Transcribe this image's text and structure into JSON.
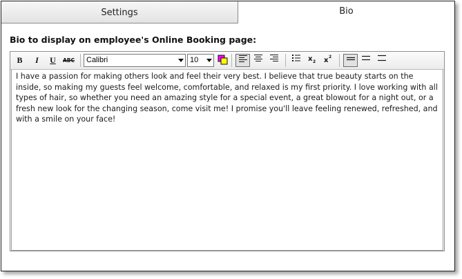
{
  "tabs": [
    {
      "label": "Settings"
    },
    {
      "label": "Bio"
    }
  ],
  "section_heading": "Bio to display on employee's Online Booking page:",
  "toolbar": {
    "bold_label": "B",
    "italic_label": "I",
    "underline_label": "U",
    "strikethrough_label": "ABC",
    "font_family": "Calibri",
    "font_size": "10",
    "colors": {
      "highlight_fg": "#ff00ff",
      "highlight_bg": "#ffff00"
    },
    "icons": [
      "align-left-icon",
      "align-center-icon",
      "align-right-icon",
      "bullet-list-icon",
      "subscript-icon",
      "superscript-icon",
      "line-spacing-single-icon",
      "line-spacing-1-5-icon",
      "line-spacing-double-icon"
    ]
  },
  "bio_text": "I have a passion for making others look and feel their very best. I believe that true beauty starts on the inside, so making my guests feel welcome, comfortable, and relaxed is my first priority. I love working with all types of hair, so whether you need an amazing style for a special event, a great blowout for a night out, or a fresh new look for the changing season, come visit me! I promise you'll leave feeling renewed, refreshed, and with a smile on your face!"
}
